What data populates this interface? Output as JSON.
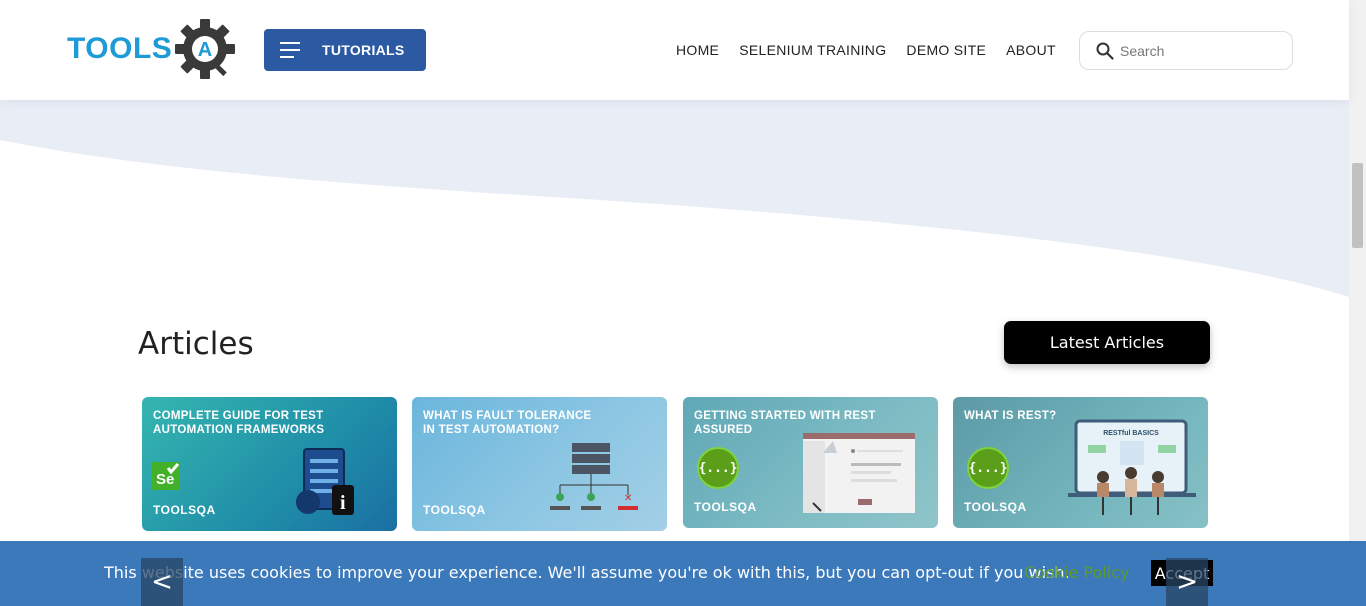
{
  "header": {
    "logo_text": "TOOLS",
    "logo_letter": "A",
    "tutorials_label": "TUTORIALS",
    "nav": [
      "HOME",
      "SELENIUM TRAINING",
      "DEMO SITE",
      "ABOUT"
    ],
    "search_placeholder": "Search"
  },
  "articles": {
    "title": "Articles",
    "latest_button": "Latest Articles",
    "cards": [
      {
        "title": "COMPLETE GUIDE FOR TEST AUTOMATION FRAMEWORKS",
        "brand": "TOOLSQA"
      },
      {
        "title": "WHAT IS FAULT TOLERANCE IN TEST AUTOMATION?",
        "brand": "TOOLSQA"
      },
      {
        "title": "GETTING STARTED WITH REST ASSURED",
        "brand": "TOOLSQA",
        "badge": "{...}"
      },
      {
        "title": "WHAT IS REST?",
        "brand": "TOOLSQA",
        "badge": "{...}",
        "art_label": "RESTful BASICS"
      }
    ]
  },
  "cookie": {
    "message": "This website uses cookies to improve your experience. We'll assume you're ok with this, but you can opt-out if you wish.",
    "policy_link": "Cookie Policy",
    "accept": "Accept"
  },
  "carousel": {
    "prev": "<",
    "next": ">"
  },
  "colors": {
    "brand_blue": "#2b5aa3",
    "logo_blue": "#1e9bd7",
    "cookie_bg": "#3b79bb",
    "cookie_link": "#5b9a2c",
    "wave": "#e9edf6"
  }
}
